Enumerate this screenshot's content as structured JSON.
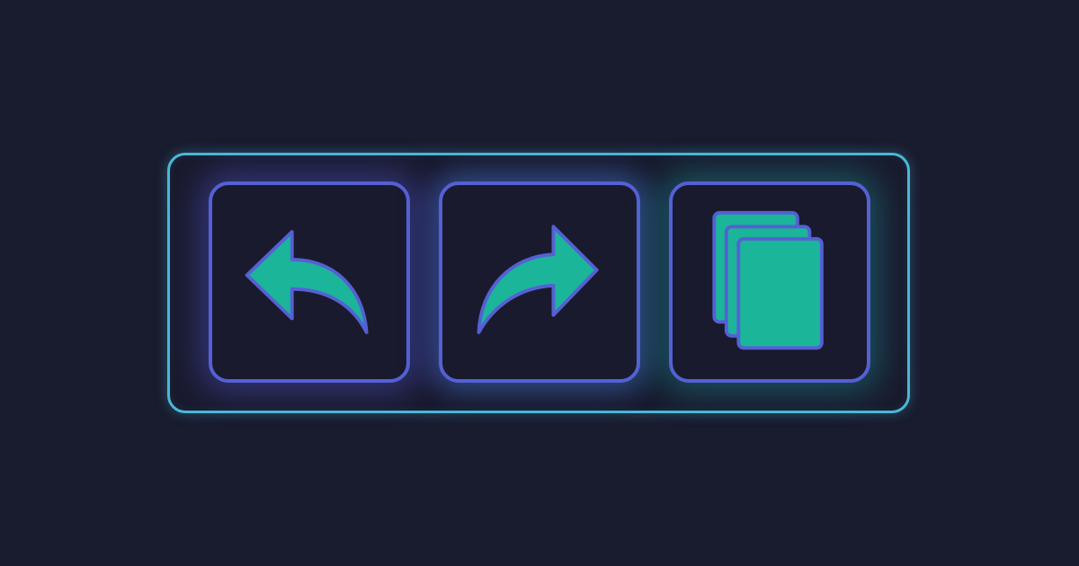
{
  "toolbar": {
    "buttons": [
      {
        "id": "undo",
        "icon": "undo-arrow-icon"
      },
      {
        "id": "redo",
        "icon": "redo-arrow-icon"
      },
      {
        "id": "copy",
        "icon": "copy-icon"
      }
    ]
  },
  "colors": {
    "background": "#191b2e",
    "toolbar_border": "#4ab8d6",
    "button_border": "#5560d4",
    "icon_fill": "#1bb59a",
    "icon_stroke": "#5560d4"
  }
}
